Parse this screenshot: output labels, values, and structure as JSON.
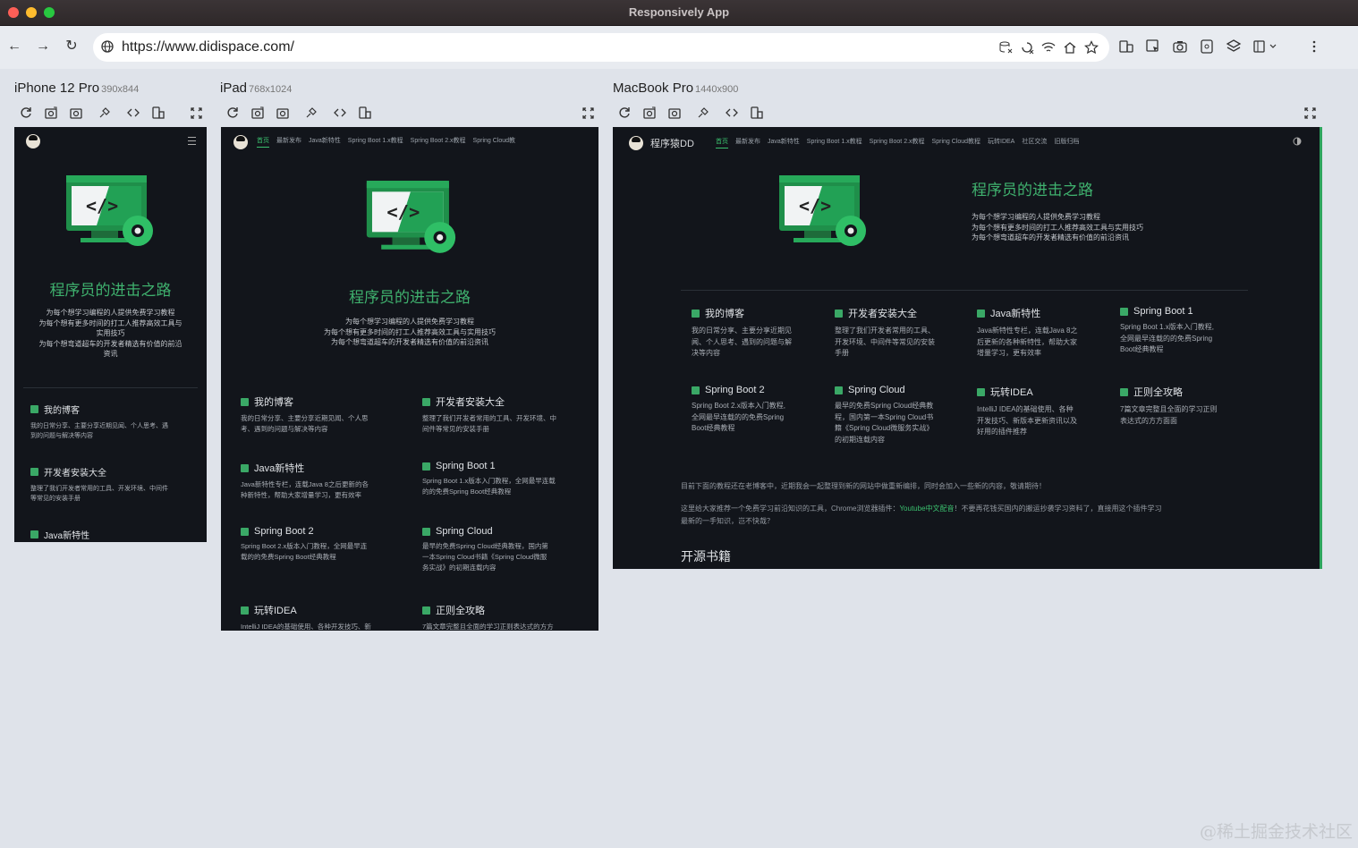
{
  "window": {
    "title": "Responsively App"
  },
  "toolbar": {
    "url": "https://www.didispace.com/"
  },
  "devices": [
    {
      "name": "iPhone 12 Pro",
      "dim": "390x844"
    },
    {
      "name": "iPad",
      "dim": "768x1024"
    },
    {
      "name": "MacBook Pro",
      "dim": "1440x900"
    }
  ],
  "site": {
    "brand": "程序猿DD",
    "nav_ipad": [
      "首页",
      "最新发布",
      "Java新特性",
      "Spring Boot 1.x教程",
      "Spring Boot 2.x教程",
      "Spring Cloud教"
    ],
    "nav_mac": [
      "首页",
      "最新发布",
      "Java新特性",
      "Spring Boot 1.x教程",
      "Spring Boot 2.x教程",
      "Spring Cloud教程",
      "玩转IDEA",
      "社区交流",
      "旧版归档"
    ],
    "hero_title": "程序员的进击之路",
    "hero_desc": [
      "为每个想学习编程的人提供免费学习教程",
      "为每个想有更多时间的打工人推荐高效工具与实用技巧",
      "为每个想弯道超车的开发者精选有价值的前沿资讯"
    ],
    "iphone_desc": [
      "为每个想学习编程的人提供免费学习教程",
      "为每个想有更多时间的打工人推荐高效工具与",
      "实用技巧",
      "为每个想弯道超车的开发者精选有价值的前沿",
      "资讯"
    ],
    "features": [
      {
        "title": "我的博客",
        "desc_iphone": [
          "我的日常分享、主要分享近期见闻、个人思考、遇",
          "到的问题与解决等内容"
        ],
        "desc_ipad": [
          "我的日常分享、主要分享近期见闻、个人思",
          "考、遇到的问题与解决等内容"
        ],
        "desc_mac": [
          "我的日常分享、主要分享近期见",
          "闻、个人思考、遇到的问题与解",
          "决等内容"
        ]
      },
      {
        "title": "开发者安装大全",
        "desc_iphone": [
          "整理了我们开发者常用的工具、开发环境、中间件",
          "等常见的安装手册"
        ],
        "desc_ipad": [
          "整理了我们开发者常用的工具、开发环境、中",
          "间件等常见的安装手册"
        ],
        "desc_mac": [
          "整理了我们开发者常用的工具、",
          "开发环境、中间件等常见的安装",
          "手册"
        ]
      },
      {
        "title": "Java新特性",
        "desc_ipad": [
          "Java新特性专栏，连载Java 8之后更新的各",
          "种新特性，帮助大家增量学习，更有效率"
        ],
        "desc_mac": [
          "Java新特性专栏，连载Java 8之",
          "后更新的各种新特性，帮助大家",
          "增量学习，更有效率"
        ]
      },
      {
        "title": "Spring Boot 1",
        "desc_ipad": [
          "Spring Boot 1.x版本入门教程，全网最早连载",
          "的的免费Spring Boot经典教程"
        ],
        "desc_mac": [
          "Spring Boot 1.x版本入门教程,",
          "全网最早连载的的免费Spring",
          "Boot经典教程"
        ]
      },
      {
        "title": "Spring Boot 2",
        "desc_ipad": [
          "Spring Boot 2.x版本入门教程，全网最早连",
          "载的的免费Spring Boot经典教程"
        ],
        "desc_mac": [
          "Spring Boot 2.x版本入门教程,",
          "全网最早连载的的免费Spring",
          "Boot经典教程"
        ]
      },
      {
        "title": "Spring Cloud",
        "desc_ipad": [
          "最早的免费Spring Cloud经典教程，国内第",
          "一本Spring Cloud书籍《Spring Cloud微服",
          "务实战》的初期连载内容"
        ],
        "desc_mac": [
          "最早的免费Spring Cloud经典教",
          "程，国内第一本Spring Cloud书",
          "籍《Spring Cloud微服务实战》",
          "的初期连载内容"
        ]
      },
      {
        "title": "玩转IDEA",
        "desc_ipad": [
          "IntelliJ IDEA的基础使用、各种开发技巧、新"
        ],
        "desc_mac": [
          "IntelliJ IDEA的基础使用、各种",
          "开发技巧、新版本更新资讯以及",
          "好用的插件推荐"
        ]
      },
      {
        "title": "正则全攻略",
        "desc_ipad": [
          "7篇文章完整且全面的学习正则表达式的方方"
        ],
        "desc_mac": [
          "7篇文章完整且全面的学习正则",
          "表达式的方方面面"
        ]
      }
    ],
    "para1": "目前下面的教程还在老博客中，近期我会一起整理到新的网站中做重新编排，同时会加入一些新的内容，敬请期待！",
    "para2_a": "这里给大家推荐一个免费学习前沿知识的工具，Chrome浏览器插件：",
    "para2_link": "Youtube中文配音",
    "para2_b": "！不要再花钱买国内的搬运抄袭学习资料了，直接用这个插件学习",
    "para2_c": "最新的一手知识，岂不快哉？",
    "section_title": "开源书籍"
  },
  "watermark": "@稀土掘金技术社区",
  "colors": {
    "accent": "#3fb16e",
    "site_bg": "#12151b",
    "app_bg": "#dfe3ea"
  }
}
